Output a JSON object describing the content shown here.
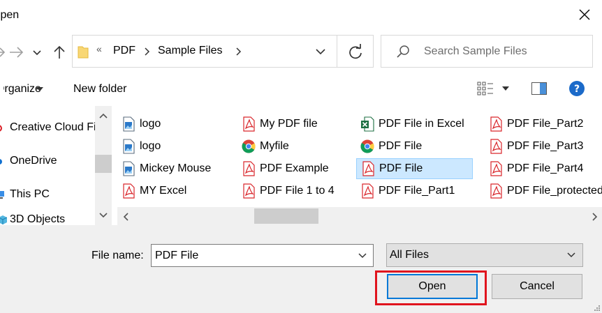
{
  "window": {
    "title": "Open"
  },
  "address": {
    "crumbs": [
      "PDF",
      "Sample Files"
    ],
    "overflow_glyph": "«"
  },
  "search": {
    "placeholder": "Search Sample Files"
  },
  "commandbar": {
    "organize": "Organize",
    "new_folder": "New folder"
  },
  "nav": {
    "items": [
      {
        "label": "Creative Cloud Files",
        "icon": "creative-cloud-icon"
      },
      {
        "label": "OneDrive",
        "icon": "onedrive-icon"
      },
      {
        "label": "This PC",
        "icon": "this-pc-icon"
      },
      {
        "label": "3D Objects",
        "icon": "3d-objects-icon"
      }
    ]
  },
  "files": [
    [
      {
        "name": "logo",
        "icon": "image-file-icon"
      },
      {
        "name": "logo",
        "icon": "image-file-icon"
      },
      {
        "name": "Mickey Mouse",
        "icon": "image-file-icon"
      },
      {
        "name": "MY Excel",
        "icon": "pdf-icon"
      }
    ],
    [
      {
        "name": "My PDF file",
        "icon": "pdf-icon"
      },
      {
        "name": "Myfile",
        "icon": "chrome-icon"
      },
      {
        "name": "PDF Example",
        "icon": "pdf-icon"
      },
      {
        "name": "PDF File 1 to 4",
        "icon": "pdf-icon"
      }
    ],
    [
      {
        "name": "PDF File in Excel",
        "icon": "excel-icon"
      },
      {
        "name": "PDF File",
        "icon": "chrome-icon"
      },
      {
        "name": "PDF File",
        "icon": "pdf-icon",
        "selected": true
      },
      {
        "name": "PDF File_Part1",
        "icon": "pdf-icon"
      }
    ],
    [
      {
        "name": "PDF File_Part2",
        "icon": "pdf-icon"
      },
      {
        "name": "PDF File_Part3",
        "icon": "pdf-icon"
      },
      {
        "name": "PDF File_Part4",
        "icon": "pdf-icon"
      },
      {
        "name": "PDF File_protected",
        "icon": "pdf-icon"
      }
    ]
  ],
  "footer": {
    "file_name_label": "File name:",
    "file_name_value": "PDF File",
    "file_type_value": "All Files",
    "open_label": "Open",
    "cancel_label": "Cancel"
  },
  "colors": {
    "selection": "#cce8ff",
    "accent": "#0078d7",
    "highlight": "#e0141e",
    "pdf": "#d9262b"
  }
}
